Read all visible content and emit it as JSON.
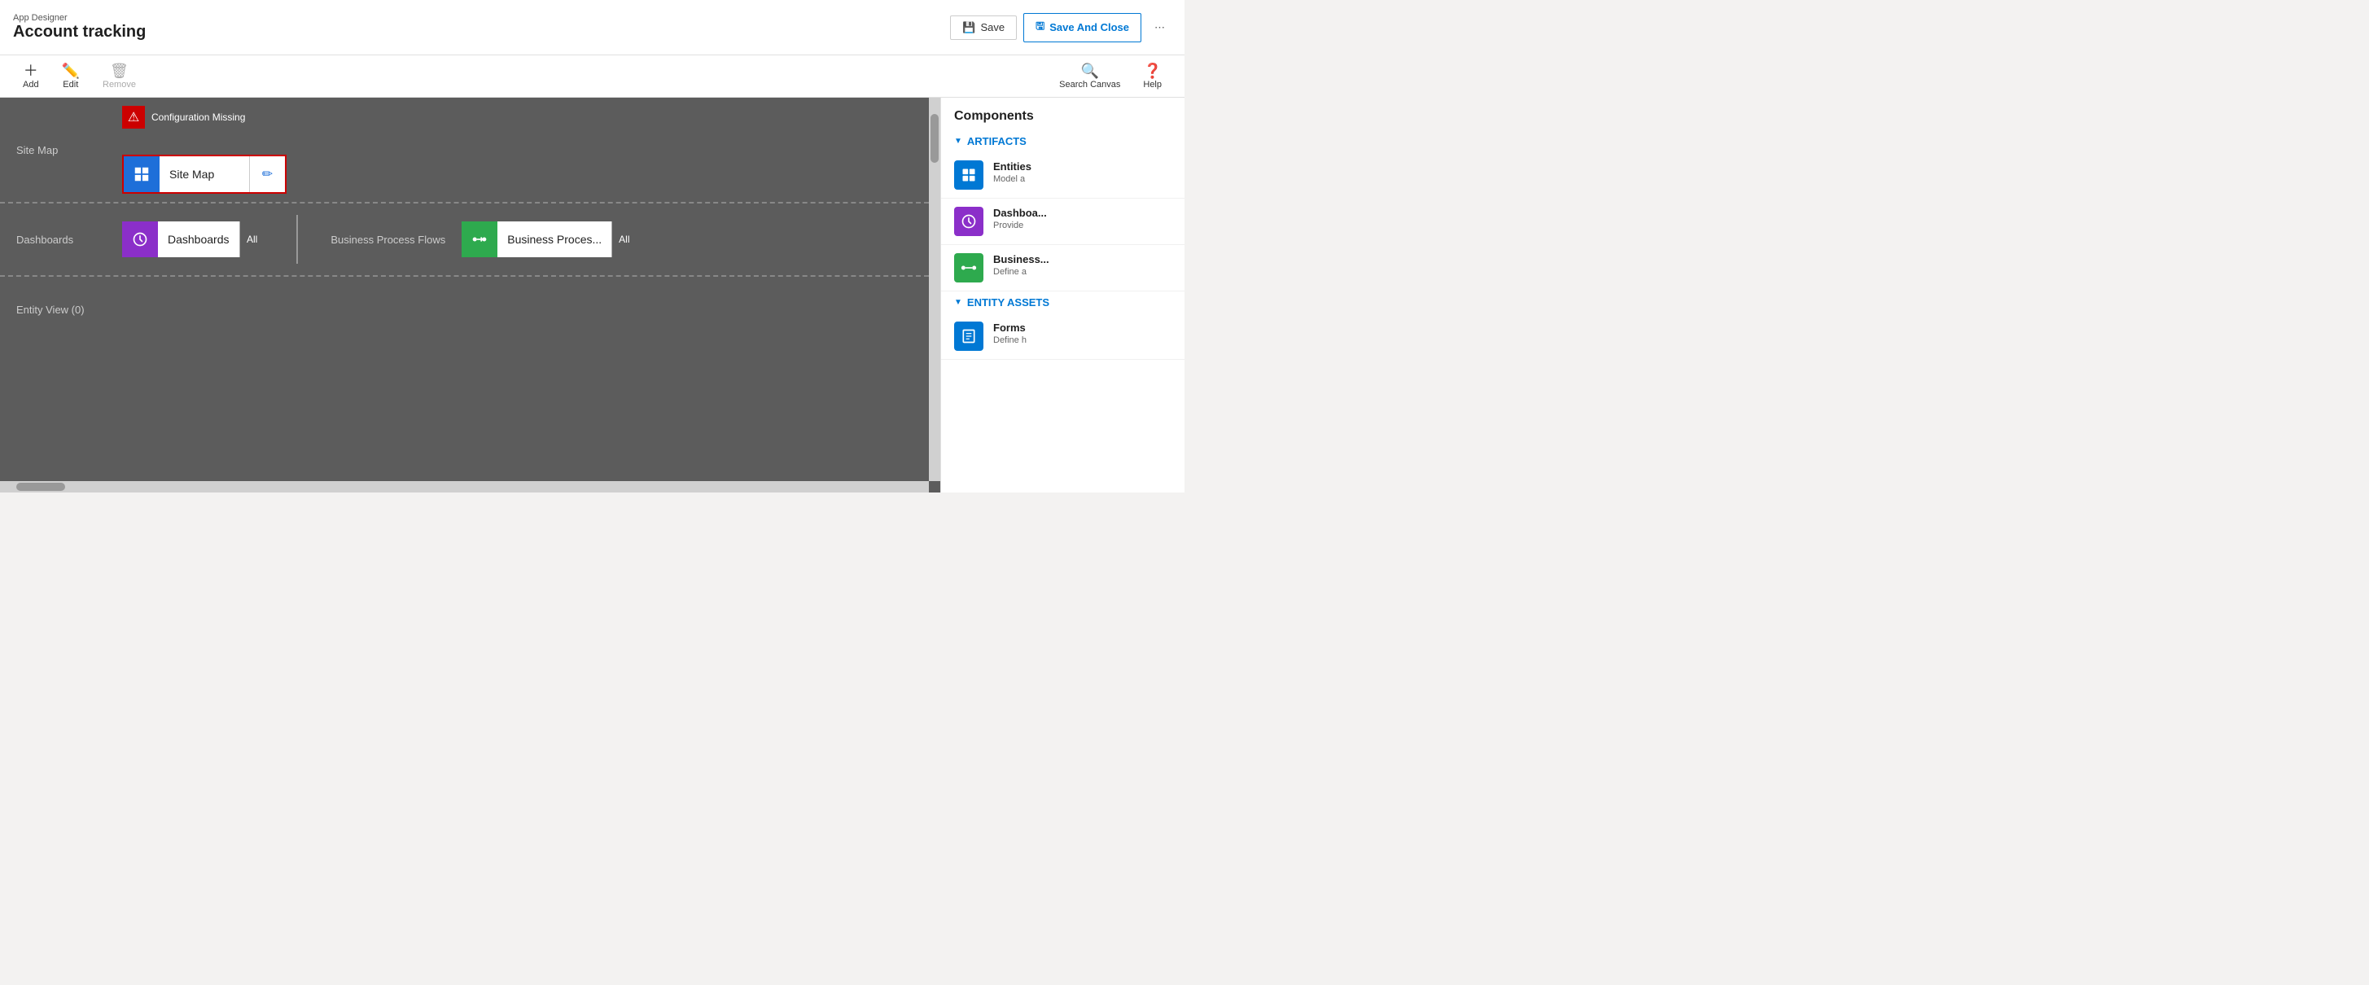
{
  "header": {
    "subtitle": "App Designer",
    "title": "Account tracking",
    "save_label": "Save",
    "save_close_label": "Save And Close"
  },
  "toolbar": {
    "add_label": "Add",
    "edit_label": "Edit",
    "remove_label": "Remove",
    "search_canvas_label": "Search Canvas",
    "help_label": "Help"
  },
  "canvas": {
    "config_missing_text": "Configuration Missing",
    "sitemap_row_label": "Site Map",
    "sitemap_card_label": "Site Map",
    "dashboards_row_label": "Dashboards",
    "dashboards_card_label": "Dashboards",
    "dashboards_all_label": "All",
    "bpf_row_label": "Business Process Flows",
    "bpf_card_label": "Business Proces...",
    "bpf_all_label": "All",
    "entity_view_label": "Entity View (0)"
  },
  "sidebar": {
    "title": "Components",
    "artifacts_section_label": "ARTIFACTS",
    "entity_assets_section_label": "ENTITY ASSETS",
    "items": [
      {
        "name": "Entities",
        "desc": "Model a",
        "icon_color": "icon-blue"
      },
      {
        "name": "Dashboa...",
        "desc": "Provide",
        "icon_color": "icon-purple"
      },
      {
        "name": "Business...",
        "desc": "Define a",
        "icon_color": "icon-green"
      },
      {
        "name": "Forms",
        "desc": "Define h",
        "icon_color": "icon-blue2"
      }
    ]
  }
}
